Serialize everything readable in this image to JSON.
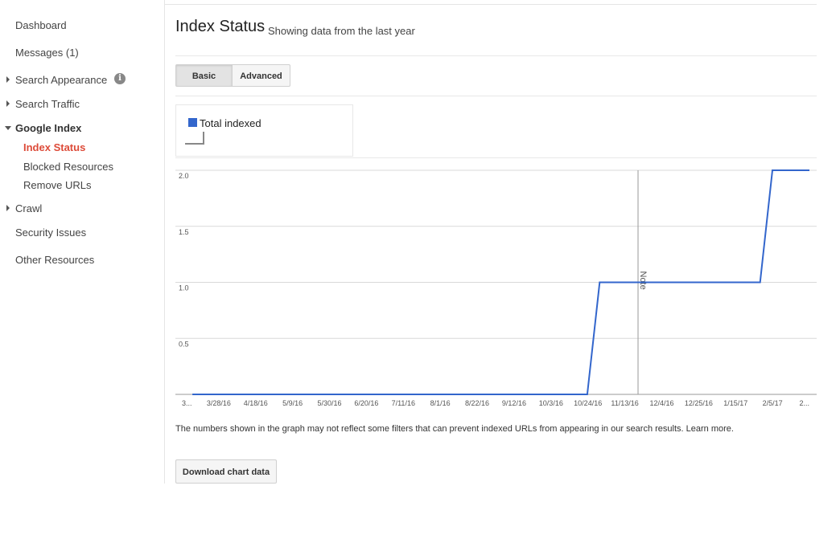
{
  "sidebar": {
    "dashboard": "Dashboard",
    "messages": "Messages (1)",
    "search_appearance": "Search Appearance",
    "search_traffic": "Search Traffic",
    "google_index": "Google Index",
    "index_status": "Index Status",
    "blocked_resources": "Blocked Resources",
    "remove_urls": "Remove URLs",
    "crawl": "Crawl",
    "security_issues": "Security Issues",
    "other_resources": "Other Resources",
    "info_glyph": "i"
  },
  "header": {
    "title": "Index Status",
    "subtitle": "Showing data from the last year"
  },
  "tabs": {
    "basic": "Basic",
    "advanced": "Advanced"
  },
  "legend": {
    "label": "Total indexed"
  },
  "footnote": "The numbers shown in the graph may not reflect some filters that can prevent indexed URLs from appearing in our search results. Learn more.",
  "download_label": "Download chart data",
  "colors": {
    "series": "#3366cc",
    "active_nav": "#dd4b39"
  },
  "chart_data": {
    "type": "line",
    "x_labels": [
      "3...",
      "3/28/16",
      "4/18/16",
      "5/9/16",
      "5/30/16",
      "6/20/16",
      "7/11/16",
      "8/1/16",
      "8/22/16",
      "9/12/16",
      "10/3/16",
      "10/24/16",
      "11/13/16",
      "12/4/16",
      "12/25/16",
      "1/15/17",
      "2/5/17",
      "2..."
    ],
    "y_ticks": [
      "2.0",
      "1.5",
      "1.0",
      "0.5"
    ],
    "ylim": [
      0,
      2
    ],
    "series": [
      {
        "name": "Total indexed",
        "points": [
          [
            "3/13/16",
            0
          ],
          [
            "10/23/16",
            0
          ],
          [
            "10/30/16",
            1
          ],
          [
            "1/29/17",
            1
          ],
          [
            "2/5/17",
            2
          ],
          [
            "2/26/17",
            2
          ]
        ]
      }
    ],
    "annotation": {
      "label": "Note",
      "date": "11/13/16"
    },
    "grid": true
  }
}
